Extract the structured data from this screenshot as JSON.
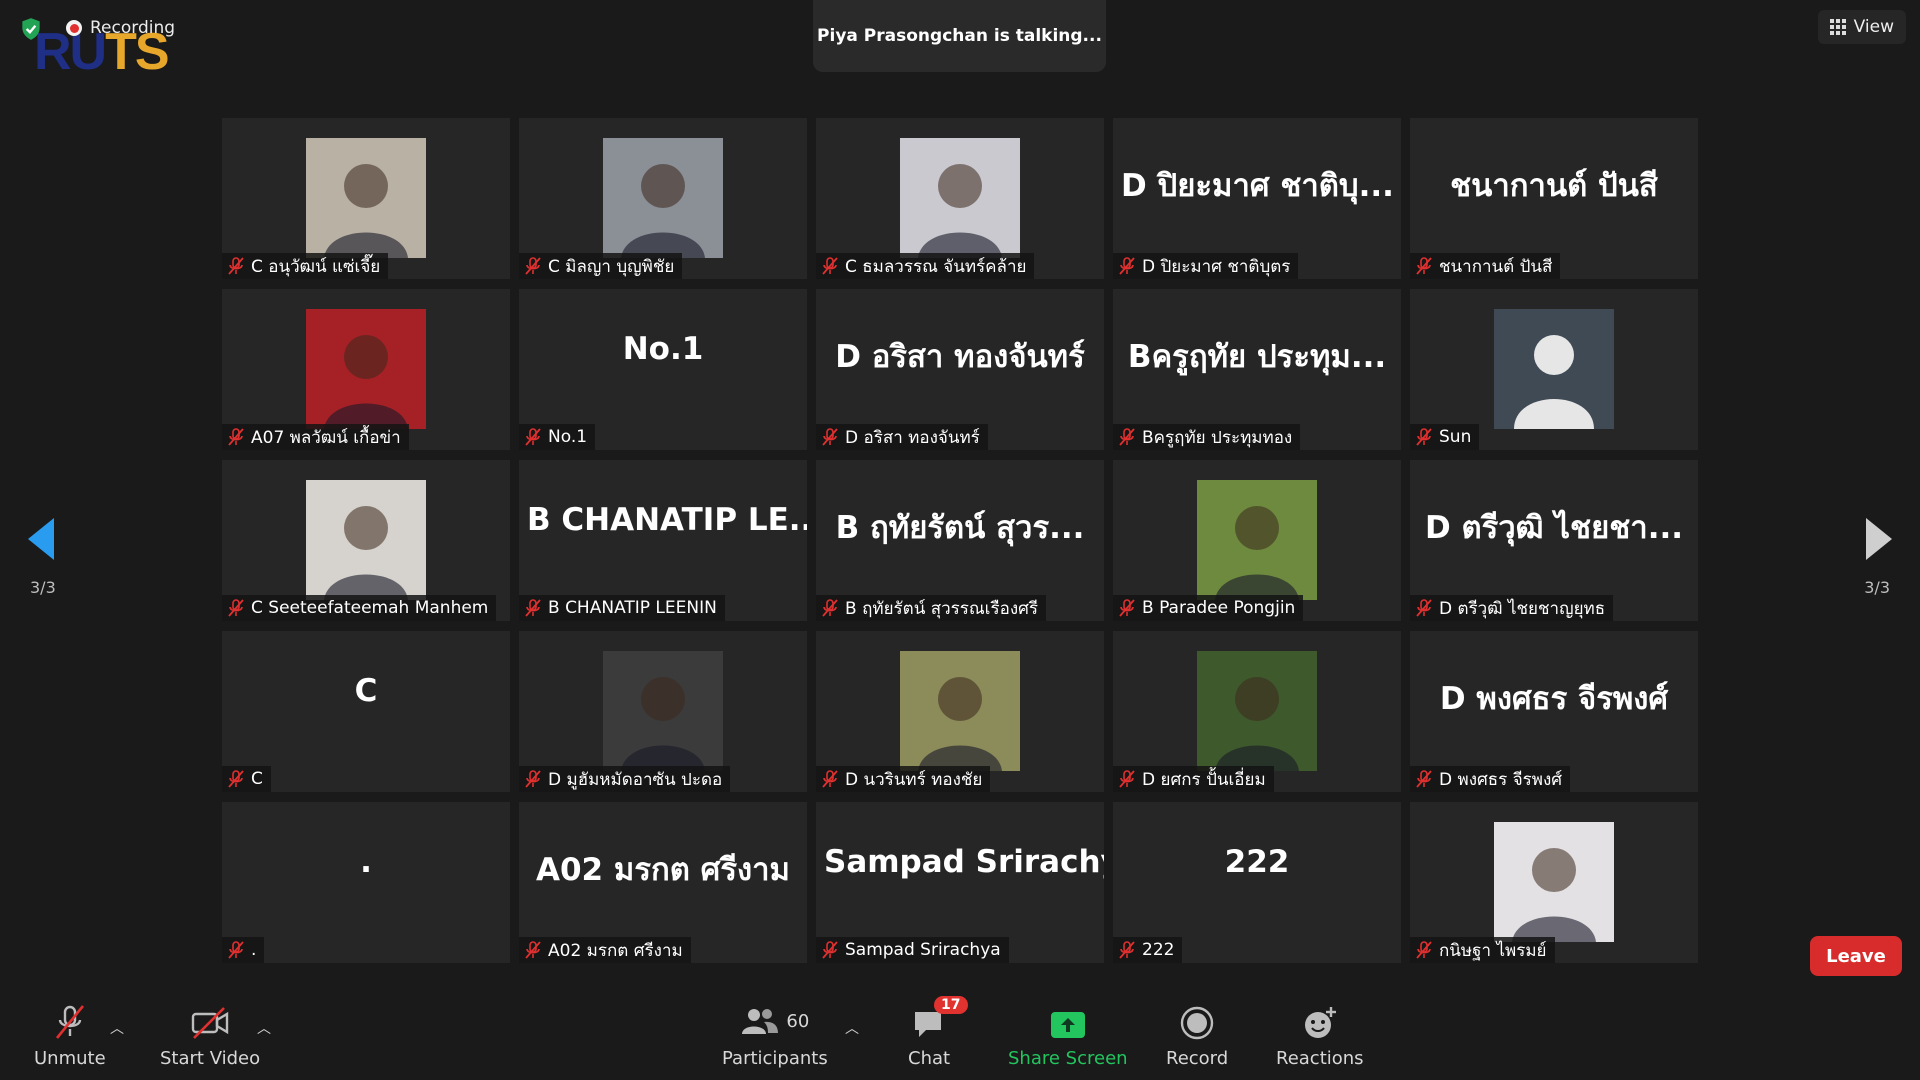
{
  "top": {
    "logo_part1": "RU",
    "logo_part2": "TS",
    "recording_label": "Recording",
    "talking_banner": "Piya Prasongchan is talking...",
    "view_label": "View"
  },
  "pagination": {
    "left": "3/3",
    "right": "3/3"
  },
  "tiles": [
    {
      "big": "",
      "name": "C อนุวัฒน์ แซ่เจี๊ย",
      "photo": true,
      "bg": "#b9b2a4"
    },
    {
      "big": "",
      "name": "C มิลญา บุญพิชัย",
      "photo": true,
      "bg": "#8b8f96"
    },
    {
      "big": "",
      "name": "C ธมลวรรณ  จันทร์คล้าย",
      "photo": true,
      "bg": "#c9c9cf"
    },
    {
      "big": "D ปิยะมาศ ชาติบุ...",
      "name": "D ปิยะมาศ ชาติบุตร",
      "photo": false
    },
    {
      "big": "ชนากานต์ ปันสี",
      "name": "ชนากานต์ ปันสี",
      "photo": false
    },
    {
      "big": "",
      "name": "A07 พลวัฒน์ เกื้อข่า",
      "photo": true,
      "bg": "#a62126"
    },
    {
      "big": "No.1",
      "name": "No.1",
      "photo": false
    },
    {
      "big": "D อริสา ทองจันทร์",
      "name": "D อริสา ทองจันทร์",
      "photo": false
    },
    {
      "big": "Bครูฤทัย ประทุม...",
      "name": "Bครูฤทัย ประทุมทอง",
      "photo": false
    },
    {
      "big": "",
      "name": "Sun",
      "photo": "avatar",
      "bg": "#3f4a55"
    },
    {
      "big": "",
      "name": "C Seeteefateemah Manhem",
      "photo": true,
      "bg": "#d6d2cd"
    },
    {
      "big": "B CHANATIP LE...",
      "name": "B CHANATIP LEENIN",
      "photo": false
    },
    {
      "big": "B ฤทัยรัตน์   สุวร...",
      "name": "B ฤทัยรัตน์  สุวรรณเรืองศรี",
      "photo": false
    },
    {
      "big": "",
      "name": "B Paradee Pongjin",
      "photo": true,
      "bg": "#6d8a3f"
    },
    {
      "big": "D ตรีวุฒิ ไชยชา...",
      "name": "D ตรีวุฒิ ไชยชาญยุทธ",
      "photo": false
    },
    {
      "big": "C",
      "name": "C",
      "photo": false
    },
    {
      "big": "",
      "name": "D มูฮัมหมัดอาซัน ปะดอ",
      "photo": true,
      "bg": "#3b3b3b"
    },
    {
      "big": "",
      "name": "D นวรินทร์ ทองชัย",
      "photo": true,
      "bg": "#8c8b5a"
    },
    {
      "big": "",
      "name": "D ยศกร ปั้นเอี่ยม",
      "photo": true,
      "bg": "#3e5a2c"
    },
    {
      "big": "D พงศธร จีรพงศ์",
      "name": "D พงศธร จีรพงศ์",
      "photo": false
    },
    {
      "big": ".",
      "name": ".",
      "photo": false
    },
    {
      "big": "A02 มรกต ศรีงาม",
      "name": "A02 มรกต ศรีงาม",
      "photo": false
    },
    {
      "big": "Sampad Srirachya",
      "name": "Sampad Srirachya",
      "photo": false
    },
    {
      "big": "222",
      "name": "222",
      "photo": false
    },
    {
      "big": "",
      "name": "กนิษฐา ไพรมย์",
      "photo": true,
      "bg": "#e3e1e3"
    }
  ],
  "toolbar": {
    "unmute": "Unmute",
    "start_video": "Start Video",
    "participants": "Participants",
    "participant_count": "60",
    "chat": "Chat",
    "chat_badge": "17",
    "share_screen": "Share Screen",
    "record": "Record",
    "reactions": "Reactions",
    "leave": "Leave"
  },
  "colors": {
    "accent_blue": "#2a9cf0",
    "share_green": "#22c55e",
    "leave_red": "#d82b2b",
    "mute_red": "#e0302f"
  }
}
